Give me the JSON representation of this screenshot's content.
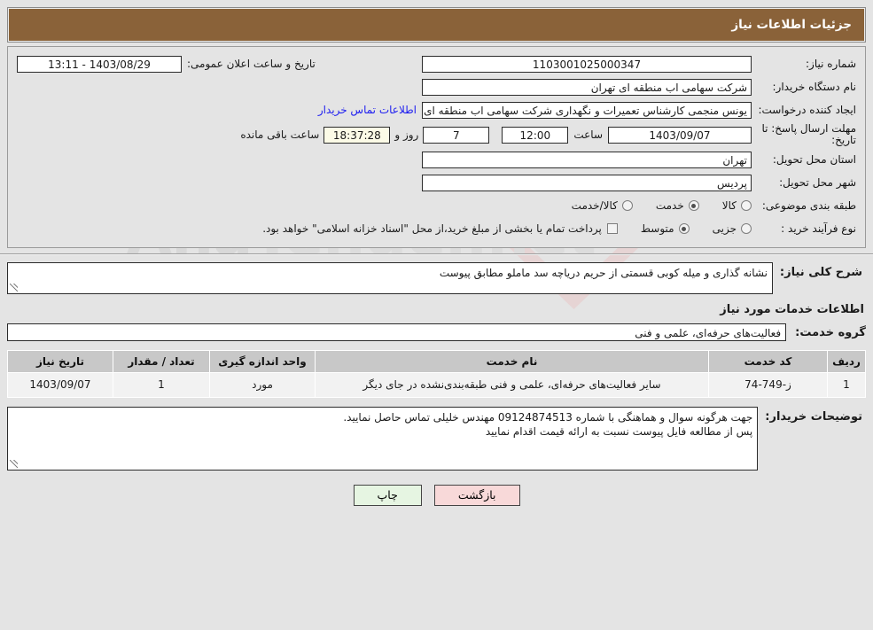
{
  "header": {
    "title": "جزئیات اطلاعات نیاز"
  },
  "form": {
    "need_number_label": "شماره نیاز:",
    "need_number_value": "1103001025000347",
    "public_announce_label": "تاریخ و ساعت اعلان عمومی:",
    "public_announce_value": "1403/08/29 - 13:11",
    "buyer_org_label": "نام دستگاه خریدار:",
    "buyer_org_value": "شرکت سهامی اب منطقه ای تهران",
    "creator_label": "ایجاد کننده درخواست:",
    "creator_value": "یونس منجمی کارشناس تعمیرات و نگهداری شرکت سهامی اب منطقه ای تهران",
    "contact_link": "اطلاعات تماس خریدار",
    "deadline_label": "مهلت ارسال پاسخ: تا تاریخ:",
    "deadline_date": "1403/09/07",
    "deadline_hour_label": "ساعت",
    "deadline_hour": "12:00",
    "remaining_days": "7",
    "remaining_days_label": "روز و",
    "remaining_time": "18:37:28",
    "remaining_suffix": "ساعت باقی مانده",
    "province_label": "استان محل تحویل:",
    "province_value": "تهران",
    "city_label": "شهر محل تحویل:",
    "city_value": "پردیس",
    "category_label": "طبقه بندی موضوعی:",
    "category_options": [
      {
        "label": "کالا",
        "selected": false
      },
      {
        "label": "خدمت",
        "selected": true
      },
      {
        "label": "کالا/خدمت",
        "selected": false
      }
    ],
    "process_label": "نوع فرآیند خرید :",
    "process_options": [
      {
        "label": "جزیی",
        "selected": false
      },
      {
        "label": "متوسط",
        "selected": true
      }
    ],
    "treasury_checkbox_text": "پرداخت تمام یا بخشی از مبلغ خرید،از محل \"اسناد خزانه اسلامی\" خواهد بود.",
    "treasury_checked": false
  },
  "description": {
    "label": "شرح کلی نیاز:",
    "value": "نشانه گذاری و میله کوبی قسمتی از حریم دریاچه سد ماملو مطابق پیوست"
  },
  "services_section": {
    "title": "اطلاعات خدمات مورد نیاز",
    "group_label": "گروه خدمت:",
    "group_value": "فعالیت‌های حرفه‌ای، علمی و فنی"
  },
  "table": {
    "headers": [
      "ردیف",
      "کد خدمت",
      "نام خدمت",
      "واحد اندازه گیری",
      "تعداد / مقدار",
      "تاریخ نیاز"
    ],
    "rows": [
      {
        "radif": "1",
        "code": "ز-749-74",
        "name": "سایر فعالیت‌های حرفه‌ای، علمی و فنی طبقه‌بندی‌نشده در جای دیگر",
        "unit": "مورد",
        "qty": "1",
        "date": "1403/09/07"
      }
    ]
  },
  "buyer_notes": {
    "label": "توضیحات خریدار:",
    "line1": "جهت هرگونه سوال و هماهنگی با شماره 09124874513 مهندس خلیلی تماس حاصل نمایید.",
    "line2": "پس از مطالعه فایل پیوست نسبت به ارائه قیمت اقدام نمایید"
  },
  "footer": {
    "print_label": "چاپ",
    "back_label": "بازگشت"
  },
  "watermark": {
    "text_left": "Ana",
    "text_right": "Tender.net"
  },
  "colors": {
    "titlebar": "#8a6239",
    "page_bg": "#e4e4e4",
    "link": "#1d1df0",
    "table_header": "#c8c8c8",
    "print_btn": "#e6f5e2",
    "back_btn": "#f8d9d9"
  }
}
